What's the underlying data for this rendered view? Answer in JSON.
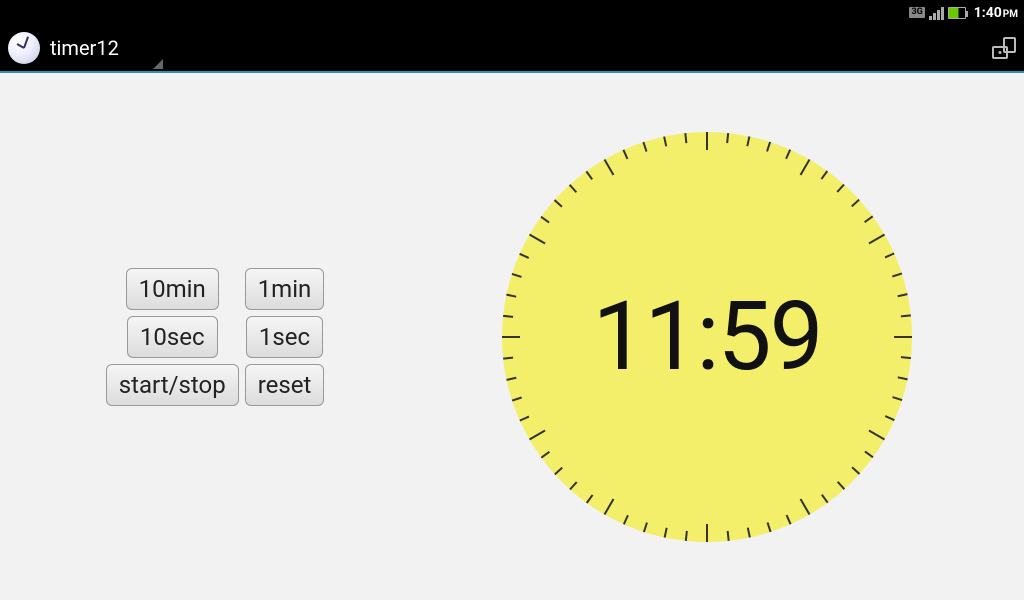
{
  "status": {
    "network": "3G",
    "time": "1:40",
    "ampm": "PM"
  },
  "titlebar": {
    "app_name": "timer12"
  },
  "controls": {
    "btn_10min": "10min",
    "btn_1min": "1min",
    "btn_10sec": "10sec",
    "btn_1sec": "1sec",
    "btn_startstop": "start/stop",
    "btn_reset": "reset"
  },
  "timer": {
    "display": "11:59"
  }
}
